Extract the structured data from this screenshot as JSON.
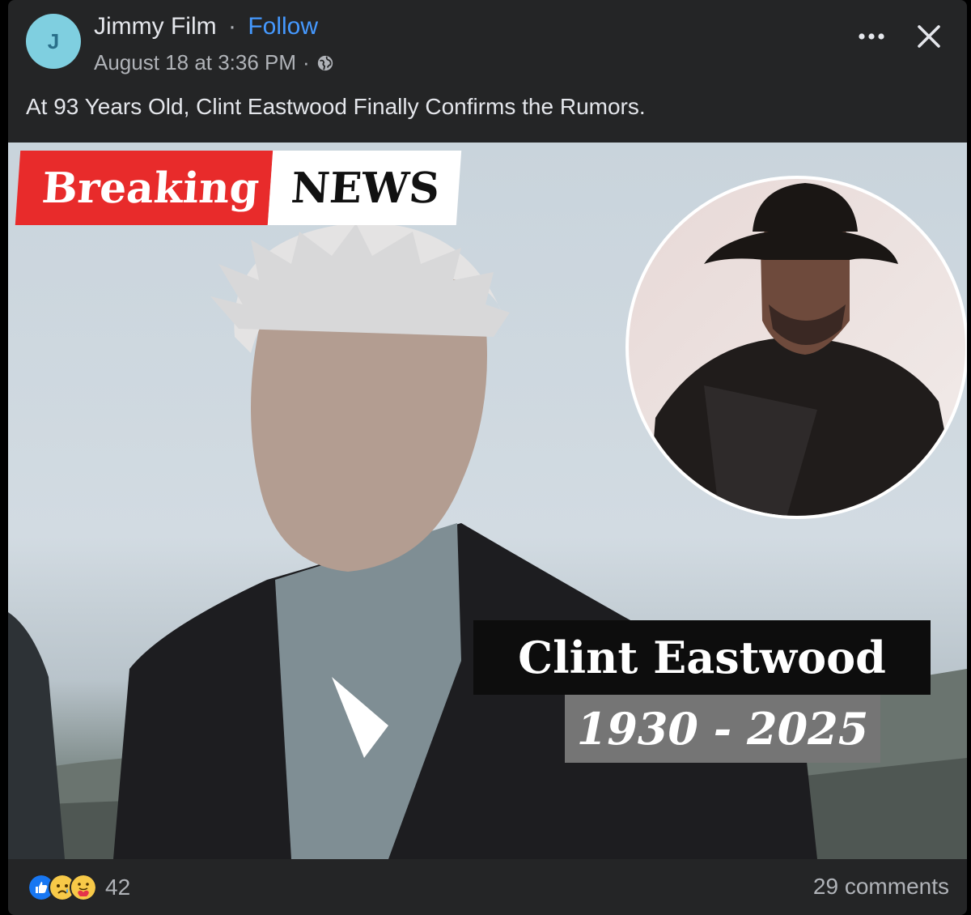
{
  "post": {
    "author": "Jimmy Film",
    "separator": "·",
    "follow_label": "Follow",
    "avatar_letter": "J",
    "timestamp": "August 18 at 3:36 PM",
    "meta_separator": "·",
    "text": "At 93 Years Old, Clint Eastwood Finally Confirms the Rumors."
  },
  "image": {
    "breaking_word": "Breaking",
    "news_word": "NEWS",
    "name": "Clint Eastwood",
    "years": "1930 - 2025"
  },
  "footer": {
    "reaction_count": "42",
    "comments": "29 comments"
  },
  "icons": {
    "menu": "more-options-icon",
    "close": "close-icon",
    "privacy": "globe-icon",
    "reactions": [
      "like-icon",
      "sad-icon",
      "care-icon"
    ]
  },
  "colors": {
    "card_bg": "#242526",
    "follow": "#4599ff",
    "breaking_red": "#e82b2b",
    "like_blue": "#1877f2"
  }
}
